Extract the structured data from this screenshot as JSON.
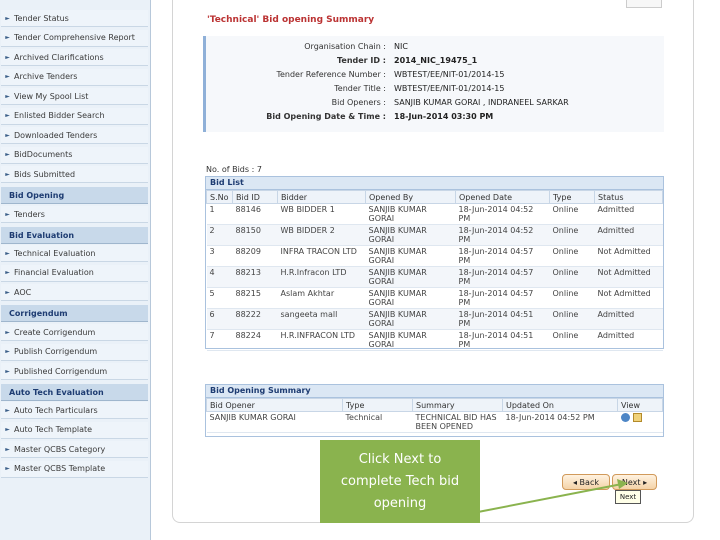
{
  "sidebar": {
    "items_top": [
      {
        "label": "Tender Status"
      },
      {
        "label": "Tender Comprehensive Report"
      },
      {
        "label": "Archived Clarifications"
      },
      {
        "label": "Archive Tenders"
      },
      {
        "label": "View My Spool List"
      },
      {
        "label": "Enlisted Bidder Search"
      },
      {
        "label": "Downloaded Tenders"
      },
      {
        "label": "BidDocuments"
      },
      {
        "label": "Bids Submitted"
      }
    ],
    "head_bid_opening": "Bid Opening",
    "bid_opening_items": [
      {
        "label": "Tenders"
      }
    ],
    "head_bid_evaluation": "Bid Evaluation",
    "bid_evaluation_items": [
      {
        "label": "Technical Evaluation"
      },
      {
        "label": "Financial Evaluation"
      },
      {
        "label": "AOC"
      }
    ],
    "head_corrigendum": "Corrigendum",
    "corrigendum_items": [
      {
        "label": "Create Corrigendum"
      },
      {
        "label": "Publish Corrigendum"
      },
      {
        "label": "Published Corrigendum"
      }
    ],
    "head_auto_tech": "Auto Tech Evaluation",
    "auto_tech_items": [
      {
        "label": "Auto Tech Particulars"
      },
      {
        "label": "Auto Tech Template"
      },
      {
        "label": "Master QCBS Category"
      },
      {
        "label": "Master QCBS Template"
      }
    ]
  },
  "page": {
    "title": "'Technical' Bid opening Summary"
  },
  "summary": {
    "rows": [
      {
        "k": "Organisation Chain :",
        "v": "NIC",
        "bold": false
      },
      {
        "k": "Tender ID :",
        "v": "2014_NIC_19475_1",
        "bold": true
      },
      {
        "k": "Tender Reference Number :",
        "v": "WBTEST/EE/NIT-01/2014-15",
        "bold": false
      },
      {
        "k": "Tender Title :",
        "v": "WBTEST/EE/NIT-01/2014-15",
        "bold": false
      },
      {
        "k": "Bid Openers :",
        "v": "SANJIB KUMAR GORAI , INDRANEEL SARKAR",
        "bold": false
      },
      {
        "k": "Bid Opening Date & Time :",
        "v": "18-Jun-2014 03:30 PM",
        "bold": true
      }
    ]
  },
  "bids_count": "No. of Bids : 7",
  "bid_list": {
    "title": "Bid List",
    "headers": [
      "S.No",
      "Bid ID",
      "Bidder",
      "Opened By",
      "Opened Date",
      "Type",
      "Status"
    ],
    "rows": [
      [
        "1",
        "88146",
        "WB BIDDER 1",
        "SANJIB KUMAR GORAI",
        "18-Jun-2014 04:52 PM",
        "Online",
        "Admitted"
      ],
      [
        "2",
        "88150",
        "WB BIDDER 2",
        "SANJIB KUMAR GORAI",
        "18-Jun-2014 04:52 PM",
        "Online",
        "Admitted"
      ],
      [
        "3",
        "88209",
        "INFRA TRACON LTD",
        "SANJIB KUMAR GORAI",
        "18-Jun-2014 04:57 PM",
        "Online",
        "Not Admitted"
      ],
      [
        "4",
        "88213",
        "H.R.Infracon LTD",
        "SANJIB KUMAR GORAI",
        "18-Jun-2014 04:57 PM",
        "Online",
        "Not Admitted"
      ],
      [
        "5",
        "88215",
        "Aslam Akhtar",
        "SANJIB KUMAR GORAI",
        "18-Jun-2014 04:57 PM",
        "Online",
        "Not Admitted"
      ],
      [
        "6",
        "88222",
        "sangeeta mall",
        "SANJIB KUMAR GORAI",
        "18-Jun-2014 04:51 PM",
        "Online",
        "Admitted"
      ],
      [
        "7",
        "88224",
        "H.R.INFRACON LTD",
        "SANJIB KUMAR GORAI",
        "18-Jun-2014 04:51 PM",
        "Online",
        "Admitted"
      ]
    ]
  },
  "opening_summary": {
    "title": "Bid Opening Summary",
    "headers": [
      "Bid Opener",
      "Type",
      "Summary",
      "Updated On",
      "View"
    ],
    "row": [
      "SANJIB KUMAR GORAI",
      "Technical",
      "TECHNICAL BID HAS BEEN OPENED",
      "18-Jun-2014 04:52 PM",
      ""
    ]
  },
  "buttons": {
    "back": "◂ Back",
    "next": "Next ▸",
    "tooltip": "Next"
  },
  "callout": {
    "line1": "Click Next to",
    "line2": "complete Tech bid",
    "line3": "opening"
  },
  "colors": {
    "callout_bg": "#8ab34e",
    "title_red": "#b33333",
    "sidebar_bg": "#eaf1f8"
  }
}
